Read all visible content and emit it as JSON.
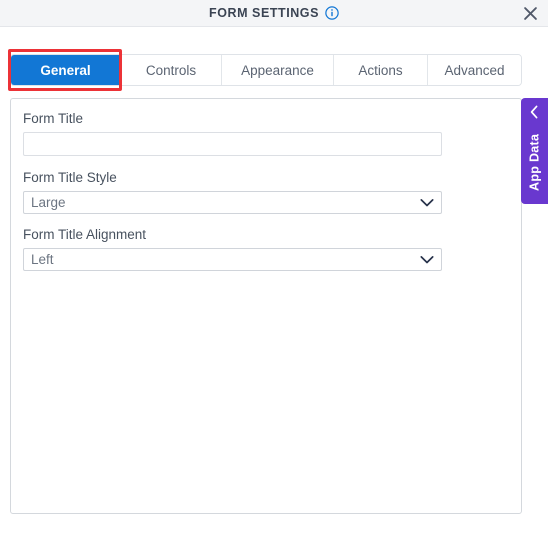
{
  "window": {
    "title": "FORM SETTINGS",
    "info_icon": "info-circle-icon",
    "close_icon": "close-icon"
  },
  "tabs": [
    {
      "label": "General",
      "active": true,
      "name": "tab-general"
    },
    {
      "label": "Controls",
      "active": false,
      "name": "tab-controls"
    },
    {
      "label": "Appearance",
      "active": false,
      "name": "tab-appearance"
    },
    {
      "label": "Actions",
      "active": false,
      "name": "tab-actions"
    },
    {
      "label": "Advanced",
      "active": false,
      "name": "tab-advanced"
    }
  ],
  "form": {
    "fields": [
      {
        "label": "Form Title",
        "type": "text",
        "value": "",
        "placeholder": ""
      },
      {
        "label": "Form Title Style",
        "type": "select",
        "value": "Large"
      },
      {
        "label": "Form Title Alignment",
        "type": "select",
        "value": "Left"
      }
    ]
  },
  "side_panel": {
    "label": "App Data",
    "collapse_icon": "chevron-left-icon"
  },
  "colors": {
    "accent_blue": "#1277d5",
    "highlight_red": "#ec3237",
    "app_data_purple": "#6938cf",
    "titlebar_bg": "#f4f5f7",
    "info_blue": "#1277d5"
  },
  "annotation": {
    "highlight_target": "General"
  }
}
